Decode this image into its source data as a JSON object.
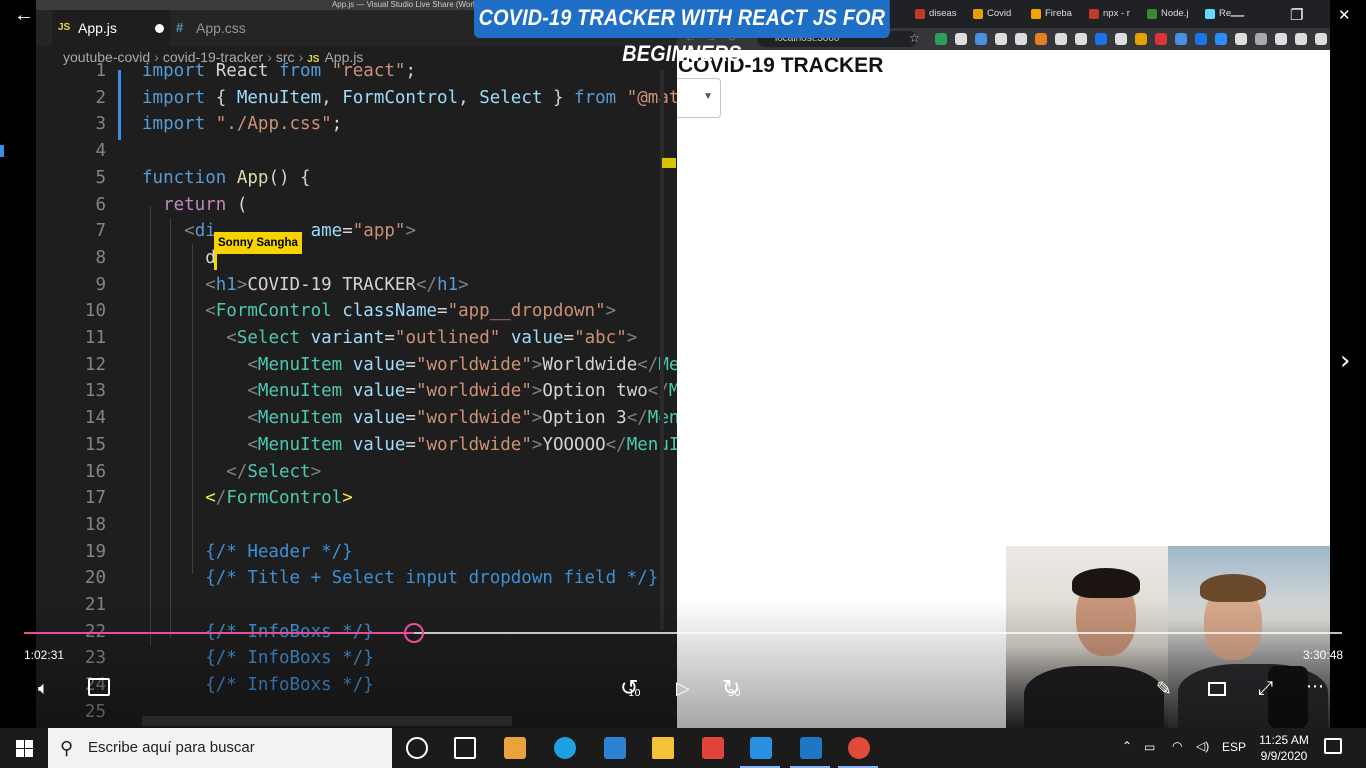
{
  "vscode": {
    "window_title": "App.js — Visual Studio Live Share (Workspace)",
    "tabs": [
      {
        "icon": "JS",
        "label": "App.js"
      },
      {
        "icon": "#",
        "label": "App.css"
      }
    ],
    "breadcrumb": [
      "youtube-covid",
      "covid-19-tracker",
      "src",
      "App.js"
    ],
    "breadcrumb_file_icon": "JS",
    "collaborator": "Sonny Sangha",
    "lines": [
      {
        "n": "1",
        "parts": [
          [
            "k",
            "import "
          ],
          [
            "w",
            "React "
          ],
          [
            "k",
            "from "
          ],
          [
            "s",
            "\"react\""
          ],
          [
            "w",
            ";"
          ]
        ]
      },
      {
        "n": "2",
        "parts": [
          [
            "k",
            "import "
          ],
          [
            "w",
            "{ "
          ],
          [
            "a",
            "MenuItem"
          ],
          [
            "w",
            ", "
          ],
          [
            "a",
            "FormControl"
          ],
          [
            "w",
            ", "
          ],
          [
            "a",
            "Select"
          ],
          [
            "w",
            " } "
          ],
          [
            "k",
            "from "
          ],
          [
            "s",
            "\"@mat"
          ]
        ]
      },
      {
        "n": "3",
        "parts": [
          [
            "k",
            "import "
          ],
          [
            "s",
            "\"./App.css\""
          ],
          [
            "w",
            ";"
          ]
        ]
      },
      {
        "n": "4",
        "parts": []
      },
      {
        "n": "5",
        "parts": [
          [
            "k",
            "function "
          ],
          [
            "f",
            "App"
          ],
          [
            "w",
            "() {"
          ]
        ]
      },
      {
        "n": "6",
        "parts": [
          [
            "w",
            "  "
          ],
          [
            "kc",
            "return "
          ],
          [
            "w",
            "("
          ]
        ]
      },
      {
        "n": "7",
        "parts": [
          [
            "w",
            "    "
          ],
          [
            "p",
            "<"
          ],
          [
            "k",
            "di"
          ],
          [
            "w",
            "         "
          ],
          [
            "a",
            "ame"
          ],
          [
            "w",
            "="
          ],
          [
            "s",
            "\"app\""
          ],
          [
            "p",
            ">"
          ]
        ]
      },
      {
        "n": "8",
        "parts": [
          [
            "w",
            "      d"
          ]
        ]
      },
      {
        "n": "9",
        "parts": [
          [
            "w",
            "      "
          ],
          [
            "p",
            "<"
          ],
          [
            "k",
            "h1"
          ],
          [
            "p",
            ">"
          ],
          [
            "w",
            "COVID-19 TRACKER"
          ],
          [
            "p",
            "</"
          ],
          [
            "k",
            "h1"
          ],
          [
            "p",
            ">"
          ]
        ]
      },
      {
        "n": "10",
        "parts": [
          [
            "w",
            "      "
          ],
          [
            "p",
            "<"
          ],
          [
            "t",
            "FormControl "
          ],
          [
            "a",
            "className"
          ],
          [
            "w",
            "="
          ],
          [
            "s",
            "\"app__dropdown\""
          ],
          [
            "p",
            ">"
          ]
        ]
      },
      {
        "n": "11",
        "parts": [
          [
            "w",
            "        "
          ],
          [
            "p",
            "<"
          ],
          [
            "t",
            "Select "
          ],
          [
            "a",
            "variant"
          ],
          [
            "w",
            "="
          ],
          [
            "s",
            "\"outlined\" "
          ],
          [
            "a",
            "value"
          ],
          [
            "w",
            "="
          ],
          [
            "s",
            "\"abc\""
          ],
          [
            "p",
            ">"
          ]
        ]
      },
      {
        "n": "12",
        "parts": [
          [
            "w",
            "          "
          ],
          [
            "p",
            "<"
          ],
          [
            "t",
            "MenuItem "
          ],
          [
            "a",
            "value"
          ],
          [
            "w",
            "="
          ],
          [
            "s",
            "\"worldwide\""
          ],
          [
            "p",
            ">"
          ],
          [
            "w",
            "Worldwide"
          ],
          [
            "p",
            "</"
          ],
          [
            "t",
            "Me"
          ]
        ]
      },
      {
        "n": "13",
        "parts": [
          [
            "w",
            "          "
          ],
          [
            "p",
            "<"
          ],
          [
            "t",
            "MenuItem "
          ],
          [
            "a",
            "value"
          ],
          [
            "w",
            "="
          ],
          [
            "s",
            "\"worldwide\""
          ],
          [
            "p",
            ">"
          ],
          [
            "w",
            "Option two"
          ],
          [
            "p",
            "</"
          ],
          [
            "t",
            "M"
          ]
        ]
      },
      {
        "n": "14",
        "parts": [
          [
            "w",
            "          "
          ],
          [
            "p",
            "<"
          ],
          [
            "t",
            "MenuItem "
          ],
          [
            "a",
            "value"
          ],
          [
            "w",
            "="
          ],
          [
            "s",
            "\"worldwide\""
          ],
          [
            "p",
            ">"
          ],
          [
            "w",
            "Option 3"
          ],
          [
            "p",
            "</"
          ],
          [
            "t",
            "Men"
          ]
        ]
      },
      {
        "n": "15",
        "parts": [
          [
            "w",
            "          "
          ],
          [
            "p",
            "<"
          ],
          [
            "t",
            "MenuItem "
          ],
          [
            "a",
            "value"
          ],
          [
            "w",
            "="
          ],
          [
            "s",
            "\"worldwide\""
          ],
          [
            "p",
            ">"
          ],
          [
            "w",
            "YOOOOO"
          ],
          [
            "p",
            "</"
          ],
          [
            "t",
            "MenuI"
          ]
        ]
      },
      {
        "n": "16",
        "parts": [
          [
            "w",
            "        "
          ],
          [
            "p",
            "</"
          ],
          [
            "t",
            "Select"
          ],
          [
            "p",
            ">"
          ]
        ]
      },
      {
        "n": "17",
        "parts": [
          [
            "w",
            "      "
          ],
          [
            "y",
            "<"
          ],
          [
            "p",
            "/"
          ],
          [
            "t",
            "FormControl"
          ],
          [
            "y",
            ">"
          ]
        ]
      },
      {
        "n": "18",
        "parts": []
      },
      {
        "n": "19",
        "parts": [
          [
            "w",
            "      "
          ],
          [
            "cm",
            "{/* Header */}"
          ]
        ]
      },
      {
        "n": "20",
        "parts": [
          [
            "w",
            "      "
          ],
          [
            "cm",
            "{/* Title + Select input dropdown field */}"
          ]
        ]
      },
      {
        "n": "21",
        "parts": []
      },
      {
        "n": "22",
        "parts": [
          [
            "w",
            "      "
          ],
          [
            "cm",
            "{/* InfoBoxs */}"
          ]
        ]
      },
      {
        "n": "23",
        "parts": [
          [
            "w",
            "      "
          ],
          [
            "cm",
            "{/* InfoBoxs */}"
          ]
        ]
      },
      {
        "n": "24",
        "parts": [
          [
            "w",
            "      "
          ],
          [
            "cm",
            "{/* InfoBoxs */}"
          ]
        ]
      },
      {
        "n": "25",
        "parts": []
      }
    ]
  },
  "banner": "COVID-19 TRACKER WITH REACT JS FOR BEGINNERS",
  "browser": {
    "tabs": [
      "diseas",
      "Covid",
      "Fireba",
      "npx - r",
      "Node.j",
      "Re"
    ],
    "address": "localhost:3000",
    "page_title": "COVID-19 TRACKER",
    "tab_colors": [
      "#c0392b",
      "#e6a100",
      "#f4a400",
      "#c0392b",
      "#3c873a",
      "#61dafb"
    ]
  },
  "player": {
    "time_current": "1:02:31",
    "time_total": "3:30:48",
    "progress_fraction": 0.2961,
    "skip_back": "10",
    "skip_forward": "30"
  },
  "taskbar": {
    "search_placeholder": "Escribe aquí para buscar",
    "language": "ESP",
    "time": "11:25 AM",
    "date": "9/9/2020",
    "icons": [
      "cortana-icon",
      "task-view-icon",
      "store-icon",
      "edge-icon",
      "mail-icon",
      "file-explorer-icon",
      "git-icon",
      "vscode-icon",
      "movies-tv-icon",
      "chrome-icon"
    ]
  }
}
